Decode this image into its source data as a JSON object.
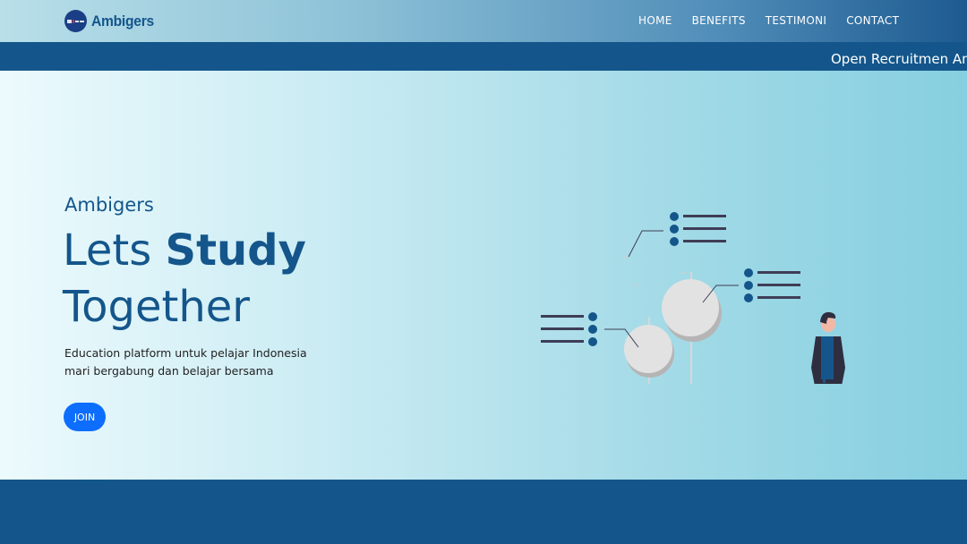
{
  "brand": {
    "name": "Ambigers",
    "logo_icon": "ambigers-logo-icon"
  },
  "nav": {
    "items": [
      {
        "label": "HOME"
      },
      {
        "label": "BENEFITS"
      },
      {
        "label": "TESTIMONI"
      },
      {
        "label": "CONTACT"
      }
    ]
  },
  "marquee": {
    "text": "Open Recruitmen Am"
  },
  "hero": {
    "subtitle": "Ambigers",
    "title_word1": "Lets",
    "title_bold": "Study",
    "title_line2": "Together",
    "description": "Education platform untuk pelajar Indonesia mari bergabung dan belajar bersama",
    "join_label": "JOIN"
  },
  "colors": {
    "primary": "#14568b",
    "button": "#0d6efd",
    "illustration_dark": "#3f3d56"
  }
}
